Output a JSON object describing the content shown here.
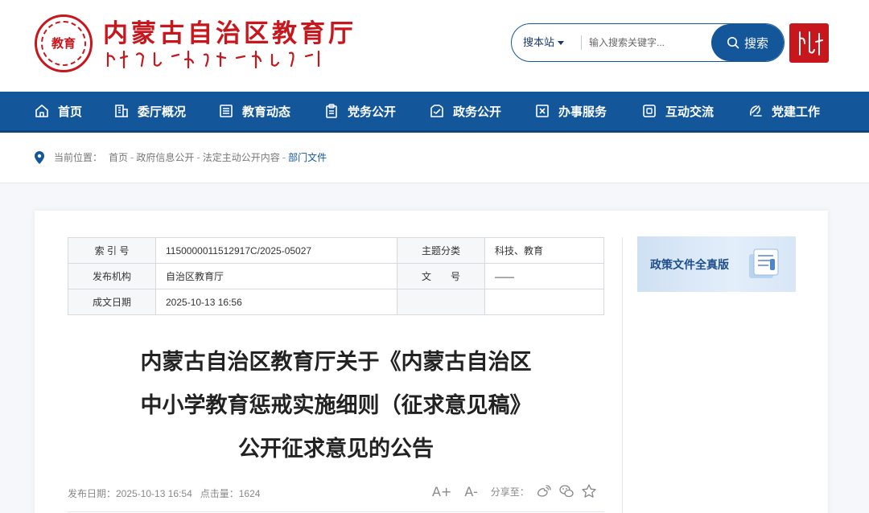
{
  "header": {
    "emblem_text": "教育",
    "site_title": "内蒙古自治区教育厅",
    "search": {
      "scope_label": "搜本站",
      "placeholder": "输入搜索关键字...",
      "button_label": "搜索"
    }
  },
  "nav": {
    "items": [
      {
        "label": "首页",
        "icon": "home-icon"
      },
      {
        "label": "委厅概况",
        "icon": "building-icon"
      },
      {
        "label": "教育动态",
        "icon": "news-list-icon"
      },
      {
        "label": "党务公开",
        "icon": "clipboard-icon"
      },
      {
        "label": "政务公开",
        "icon": "inbox-check-icon"
      },
      {
        "label": "办事服务",
        "icon": "service-icon"
      },
      {
        "label": "互动交流",
        "icon": "chat-icon"
      },
      {
        "label": "党建工作",
        "icon": "party-emblem-icon"
      }
    ]
  },
  "breadcrumb": {
    "prefix": "当前位置：",
    "items": [
      "首页",
      "政府信息公开",
      "法定主动公开内容",
      "部门文件"
    ]
  },
  "meta": {
    "index_label": "索 引 号",
    "index_value": "1150000011512917C/2025-05027",
    "topic_label": "主题分类",
    "topic_value": "科技、教育",
    "publisher_label": "发布机构",
    "publisher_value": "自治区教育厅",
    "docno_label": "文　　号",
    "docno_value": "——",
    "date_label": "成文日期",
    "date_value": "2025-10-13 16:56"
  },
  "sidebar": {
    "banner_label": "政策文件全真版"
  },
  "article": {
    "title_line1": "内蒙古自治区教育厅关于《内蒙古自治区",
    "title_line2": "中小学教育惩戒实施细则（征求意见稿》",
    "title_line3": "公开征求意见的公告",
    "publish_info": "发布日期：2025-10-13 16:54   点击量：1624",
    "font_up": "A+",
    "font_down": "A-",
    "share_label": "分享至："
  },
  "colors": {
    "brand_red": "#c8161d",
    "nav_blue": "#13579a"
  }
}
